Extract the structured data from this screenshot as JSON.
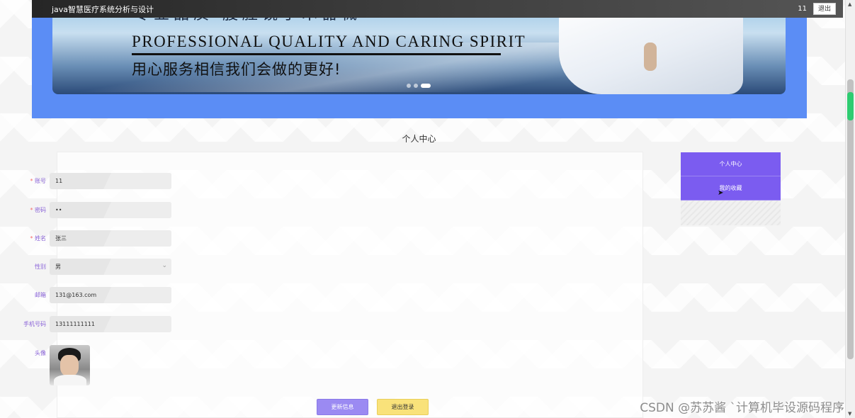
{
  "topbar": {
    "title": "java智慧医疗系统分析与设计",
    "username": "11",
    "logout_label": "退出"
  },
  "banner": {
    "cn_top": "专业品质 腹腔镜手术器械",
    "en": "PROFESSIONAL QUALITY AND CARING SPIRIT",
    "cn_bottom": "用心服务相信我们会做的更好!",
    "slide_count": 3,
    "active_slide": 3
  },
  "page": {
    "title": "个人中心"
  },
  "form": {
    "account": {
      "label": "账号",
      "value": "11",
      "required": "*"
    },
    "password": {
      "label": "密码",
      "value": "••",
      "required": "*"
    },
    "name": {
      "label": "姓名",
      "value": "张三",
      "required": "*"
    },
    "gender": {
      "label": "性别",
      "value": "男"
    },
    "email": {
      "label": "邮箱",
      "value": "131@163.com"
    },
    "phone": {
      "label": "手机号码",
      "value": "13111111111"
    },
    "avatar": {
      "label": "头像"
    }
  },
  "buttons": {
    "update": "更新信息",
    "logout": "退出登录"
  },
  "side_menu": {
    "items": [
      {
        "label": "个人中心"
      },
      {
        "label": "我的收藏"
      }
    ]
  },
  "colors": {
    "accent": "#7b5cf0",
    "banner_bg": "#5b8df5",
    "logout_btn": "#f9e27a"
  },
  "watermark": "CSDN @苏苏酱  `计算机毕设源码程序"
}
